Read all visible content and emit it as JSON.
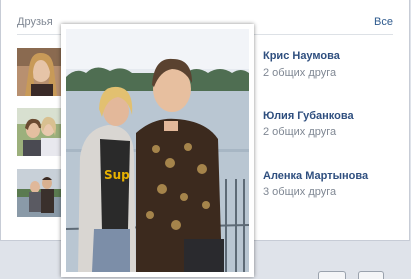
{
  "panel": {
    "title": "Друзья",
    "see_all": "Все"
  },
  "friends": [
    {
      "name": "Крис Наумова",
      "mutual": "2 общих друга"
    },
    {
      "name": "Юлия Губанкова",
      "mutual": "2 общих друга"
    },
    {
      "name": "Аленка Мартынова",
      "mutual": "3 общих друга"
    }
  ],
  "popup": {
    "shirt_text": "Sup"
  }
}
